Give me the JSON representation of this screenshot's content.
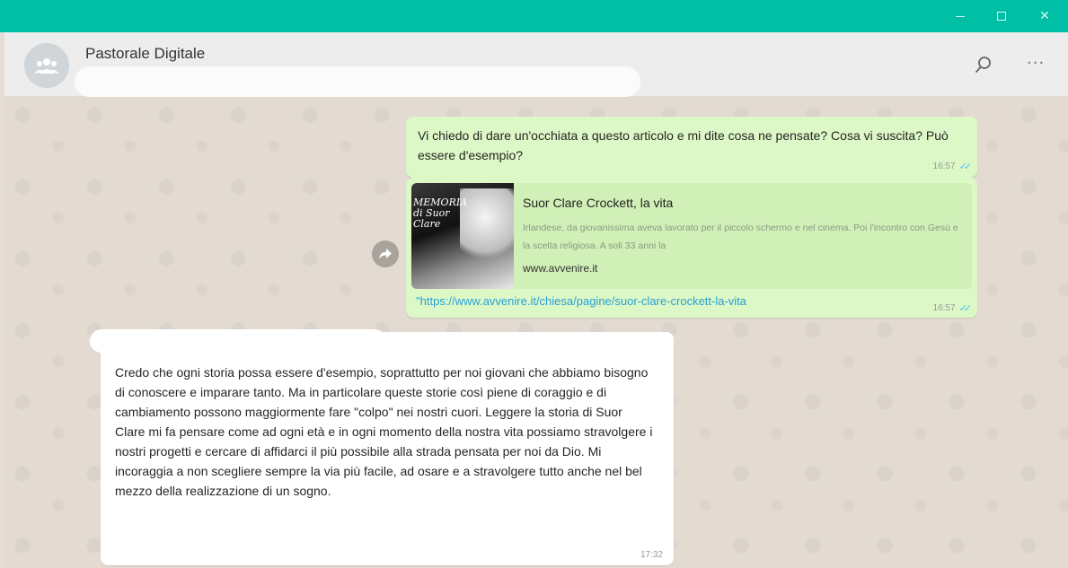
{
  "window": {
    "minimize_icon": "minimize-icon",
    "maximize_icon": "restore-icon",
    "close_label": "✕"
  },
  "header": {
    "title": "Pastorale Digitale",
    "menu_label": "···"
  },
  "messages": [
    {
      "direction": "out",
      "text": "Vi chiedo di dare un'occhiata a questo articolo e mi dite cosa ne pensate? Cosa vi suscita? Può essere d'esempio?",
      "time": "16:57",
      "status": "read"
    },
    {
      "direction": "out",
      "preview": {
        "thumb_caption": "MEMORIA di Suor Clare",
        "title": "Suor Clare Crockett, la vita",
        "description": "Irlandese, da giovanissima aveva lavorato per il piccolo schermo e nel cinema. Poi l'incontro con Gesù e la scelta religiosa. A soli 33 anni la",
        "site": "www.avvenire.it"
      },
      "link": "\"https://www.avvenire.it/chiesa/pagine/suor-clare-crockett-la-vita",
      "time": "16:57",
      "status": "read"
    },
    {
      "direction": "in",
      "text": "Credo che ogni storia possa essere d'esempio, soprattutto per noi giovani che abbiamo bisogno di conoscere e imparare tanto. Ma in particolare queste storie così piene di coraggio e di cambiamento possono maggiormente fare \"colpo\" nei nostri cuori. Leggere la storia di Suor Clare mi fa pensare come ad ogni età e in ogni momento della nostra vita possiamo stravolgere i nostri progetti e cercare di affidarci il più possibile alla strada pensata per noi da Dio. Mi incoraggia a non scegliere sempre la via più facile, ad osare e a stravolgere tutto anche nel bel mezzo della realizzazione di un sogno.",
      "time": "17:32"
    }
  ],
  "colors": {
    "titlebar": "#00bfa5",
    "outgoing_bubble": "#dcf8c6",
    "incoming_bubble": "#ffffff",
    "read_ticks": "#4fc3f7",
    "link": "#2a9fd6"
  }
}
